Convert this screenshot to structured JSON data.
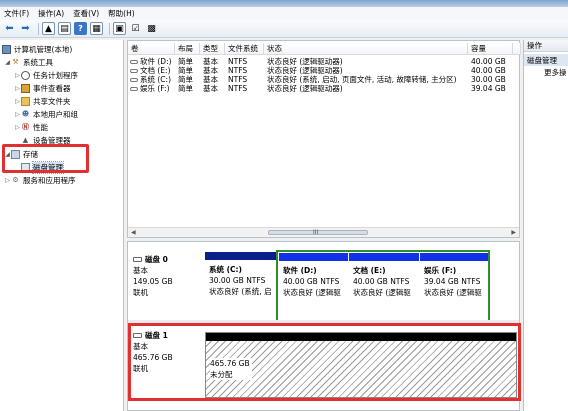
{
  "menu": [
    "文件(F)",
    "操作(A)",
    "查看(V)",
    "帮助(H)"
  ],
  "tree": {
    "root": "计算机管理(本地)",
    "system_tools": "系统工具",
    "task_scheduler": "任务计划程序",
    "event_viewer": "事件查看器",
    "shared_folders": "共享文件夹",
    "local_users": "本地用户和组",
    "performance": "性能",
    "device_manager": "设备管理器",
    "storage": "存储",
    "disk_management": "磁盘管理",
    "services": "服务和应用程序"
  },
  "volumes": {
    "headers": [
      "卷",
      "布局",
      "类型",
      "文件系统",
      "状态",
      "容量",
      ""
    ],
    "rows": [
      {
        "name": "软件 (D:)",
        "layout": "简单",
        "type": "基本",
        "fs": "NTFS",
        "status": "状态良好 (逻辑驱动器)",
        "capacity": "40.00 GB"
      },
      {
        "name": "文档 (E:)",
        "layout": "简单",
        "type": "基本",
        "fs": "NTFS",
        "status": "状态良好 (逻辑驱动器)",
        "capacity": "40.00 GB"
      },
      {
        "name": "系统 (C:)",
        "layout": "简单",
        "type": "基本",
        "fs": "NTFS",
        "status": "状态良好 (系统, 启动, 页面文件, 活动, 故障转储, 主分区)",
        "capacity": "30.00 GB"
      },
      {
        "name": "娱乐 (F:)",
        "layout": "简单",
        "type": "基本",
        "fs": "NTFS",
        "status": "状态良好 (逻辑驱动器)",
        "capacity": "39.04 GB"
      }
    ],
    "scroll_mid": "III"
  },
  "actions": {
    "header": "操作",
    "item": "磁盘管理",
    "more": "更多操"
  },
  "disk0": {
    "name": "磁盘 0",
    "type": "基本",
    "size": "149.05 GB",
    "state": "联机",
    "partitions": [
      {
        "name": "系统 (C:)",
        "size": "30.00 GB NTFS",
        "status": "状态良好 (系统, 启"
      },
      {
        "name": "软件 (D:)",
        "size": "40.00 GB NTFS",
        "status": "状态良好 (逻辑驱"
      },
      {
        "name": "文档 (E:)",
        "size": "40.00 GB NTFS",
        "status": "状态良好 (逻辑驱"
      },
      {
        "name": "娱乐 (F:)",
        "size": "39.04 GB NTFS",
        "status": "状态良好 (逻辑驱"
      }
    ]
  },
  "disk1": {
    "name": "磁盘 1",
    "type": "基本",
    "size": "465.76 GB",
    "state": "联机",
    "unalloc_size": "465.76 GB",
    "unalloc_label": "未分配"
  },
  "colors": {
    "highlight_red": "#e03030",
    "logical_green": "#2f8c2f",
    "primary_navy": "#0b1f8a",
    "logical_blue": "#1230e8"
  }
}
